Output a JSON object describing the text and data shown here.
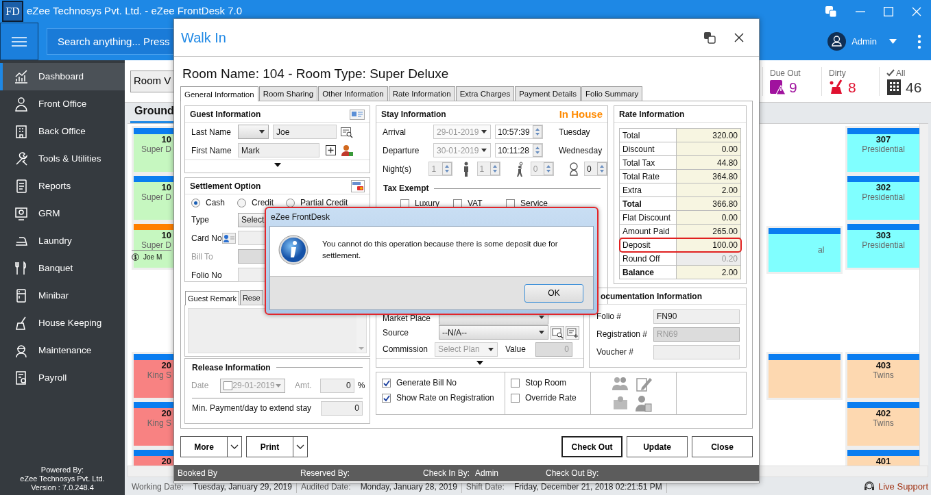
{
  "app": {
    "logo": "FD",
    "title": "eZee Technosys Pvt. Ltd. - eZee FrontDesk 7.0",
    "search": {
      "placeholder": "Search anything... Press"
    },
    "user": "Admin"
  },
  "sidebar": {
    "items": [
      {
        "label": "Dashboard",
        "kind": "dashboard",
        "selected": true
      },
      {
        "label": "Front Office",
        "kind": "front-office",
        "selected": false
      },
      {
        "label": "Back Office",
        "kind": "back-office",
        "selected": false
      },
      {
        "label": "Tools & Utilities",
        "kind": "tools",
        "selected": false
      },
      {
        "label": "Reports",
        "kind": "reports",
        "selected": false
      },
      {
        "label": "GRM",
        "kind": "grm",
        "selected": false
      },
      {
        "label": "Laundry",
        "kind": "laundry",
        "selected": false
      },
      {
        "label": "Banquet",
        "kind": "banquet",
        "selected": false
      },
      {
        "label": "Minibar",
        "kind": "minibar",
        "selected": false
      },
      {
        "label": "House Keeping",
        "kind": "housekeeping",
        "selected": false
      },
      {
        "label": "Maintenance",
        "kind": "maintenance",
        "selected": false
      },
      {
        "label": "Payroll",
        "kind": "payroll",
        "selected": false
      }
    ],
    "footer": [
      "Powered By:",
      "eZee Technosys Pvt. Ltd.",
      "Version : 7.0.248.4"
    ]
  },
  "toolbar": {
    "view_button": "Room V",
    "stats": [
      {
        "label": "Due Out",
        "value": "9",
        "kind": "due-out",
        "color": "#a0129e"
      },
      {
        "label": "Dirty",
        "value": "8",
        "kind": "dirty",
        "color": "#e0102f"
      },
      {
        "label": "All",
        "value": "46",
        "kind": "all",
        "color": "#333333"
      }
    ]
  },
  "floor_tabs": [
    {
      "label": "Ground",
      "selected": true
    }
  ],
  "room_groups": [
    {
      "columns": [
        {
          "rooms": [
            {
              "number": "10",
              "type": "Super D",
              "kind": "vacant",
              "color": "#c6f7c0"
            },
            {
              "number": "10",
              "type": "Super D",
              "kind": "vacant",
              "color": "#c6f7c0"
            },
            {
              "number": "10",
              "type": "Super D",
              "guest": "Joe M",
              "kind": "occupied",
              "color": "#c6f7c0"
            }
          ]
        },
        {
          "rooms": [
            {
              "type": "al",
              "kind": "vacant",
              "color": "#80ffff"
            }
          ]
        },
        {
          "rooms": [
            {
              "number": "307",
              "type": "Presidential",
              "kind": "vacant",
              "color": "#80ffff"
            },
            {
              "number": "302",
              "type": "Presidential",
              "kind": "vacant",
              "color": "#80ffff"
            },
            {
              "number": "303",
              "type": "Presidential",
              "kind": "vacant",
              "color": "#80ffff"
            }
          ]
        }
      ]
    },
    {
      "columns": [
        {
          "rooms": [
            {
              "number": "20",
              "type": "King S",
              "kind": "vacant",
              "color": "#f88282"
            },
            {
              "number": "20",
              "type": "King S",
              "kind": "vacant",
              "color": "#f88282"
            },
            {
              "number": "20",
              "kind": "vacant",
              "color": "#f88282"
            }
          ]
        },
        {
          "rooms": [
            {
              "kind": "vacant",
              "color": "#fdd8b0"
            }
          ]
        },
        {
          "rooms": [
            {
              "number": "403",
              "type": "Twins",
              "kind": "vacant",
              "color": "#fdd8b0"
            },
            {
              "number": "402",
              "type": "Twins",
              "kind": "vacant",
              "color": "#fdd8b0"
            },
            {
              "number": "401",
              "kind": "vacant",
              "color": "#fdd8b0"
            }
          ]
        }
      ]
    }
  ],
  "status_bar": {
    "items": [
      {
        "label": "Working Date:",
        "value": "Tuesday, January 29, 2019"
      },
      {
        "label": "Audited Date:",
        "value": "Monday, January 28, 2019"
      },
      {
        "label": "Shift Date:",
        "value": "Friday, December 21, 2018 02:21:51 PM"
      }
    ],
    "live_support": "Live Support"
  },
  "dialog": {
    "title": "Walk In",
    "heading": "Room Name: 104 - Room Type: Super Deluxe",
    "tabs": [
      {
        "label": "General Information",
        "selected": true
      },
      {
        "label": "Room Sharing",
        "selected": false
      },
      {
        "label": "Other Information",
        "selected": false
      },
      {
        "label": "Rate Information",
        "selected": false
      },
      {
        "label": "Extra Charges",
        "selected": false
      },
      {
        "label": "Payment Details",
        "selected": false
      },
      {
        "label": "Folio Summary",
        "selected": false
      }
    ],
    "guest": {
      "title": "Guest Information",
      "last_name": {
        "label": "Last Name",
        "value": "Joe"
      },
      "first_name": {
        "label": "First Name",
        "value": "Mark"
      }
    },
    "settlement": {
      "title": "Settlement Option",
      "options": [
        {
          "label": "Cash",
          "selected": true
        },
        {
          "label": "Credit",
          "selected": false
        },
        {
          "label": "Partial Credit",
          "selected": false
        }
      ],
      "fields": [
        {
          "label": "Type",
          "kind": "select",
          "value": "Select",
          "disabled": false
        },
        {
          "label": "Card No",
          "kind": "card",
          "disabled": false
        },
        {
          "label": "Bill To",
          "kind": "text",
          "disabled": true
        },
        {
          "label": "Folio No",
          "kind": "text",
          "disabled": false
        }
      ]
    },
    "remarks": {
      "tabs": [
        {
          "label": "Guest Remark",
          "selected": true
        },
        {
          "label": "Rese",
          "selected": false
        }
      ]
    },
    "release": {
      "title": "Release Information",
      "date": {
        "label": "Date",
        "value": "29-01-2019",
        "checked": false
      },
      "amount": {
        "label": "Amt.",
        "value": "0",
        "unit": "%"
      },
      "min_payment": {
        "label": "Min. Payment/day to extend stay",
        "value": "0"
      }
    },
    "stay": {
      "title": "Stay Information",
      "status": "In House",
      "dates": [
        {
          "label": "Arrival",
          "date": "29-01-2019",
          "time": "10:57:39",
          "day": "Tuesday"
        },
        {
          "label": "Departure",
          "date": "30-01-2019",
          "time": "10:11:28",
          "day": "Wednesday"
        }
      ],
      "nights": {
        "label": "Night(s)",
        "value": "1"
      },
      "guests": [
        {
          "kind": "adult",
          "value": "1",
          "disabled": true
        },
        {
          "kind": "child",
          "value": "0",
          "disabled": true
        },
        {
          "kind": "infant",
          "value": "0",
          "disabled": false
        }
      ],
      "tax_exempt": {
        "title": "Tax Exempt",
        "options": [
          {
            "label": "Luxury",
            "checked": false
          },
          {
            "label": "VAT",
            "checked": false
          },
          {
            "label": "Service",
            "checked": false
          }
        ]
      }
    },
    "market": {
      "market_place": {
        "label": "Market Place"
      },
      "source": {
        "label": "Source",
        "value": "--N/A--"
      },
      "commission": {
        "label": "Commission",
        "value": "Select Plan"
      },
      "value": {
        "label": "Value",
        "value": "0"
      }
    },
    "rate": {
      "title": "Rate Information",
      "rows": [
        {
          "label": "Total",
          "value": "320.00",
          "kind": "normal",
          "highlighted": false,
          "disabled": false
        },
        {
          "label": "Discount",
          "value": "0.00",
          "kind": "normal",
          "highlighted": false,
          "disabled": false
        },
        {
          "label": "Total Tax",
          "value": "44.80",
          "kind": "normal",
          "highlighted": false,
          "disabled": false
        },
        {
          "label": "Total Rate",
          "value": "364.80",
          "kind": "normal",
          "highlighted": false,
          "disabled": false
        },
        {
          "label": "Extra",
          "value": "2.00",
          "kind": "normal",
          "highlighted": false,
          "disabled": false
        },
        {
          "label": "Total",
          "value": "366.80",
          "kind": "total",
          "highlighted": false,
          "disabled": false
        },
        {
          "label": "Flat Discount",
          "value": "0.00",
          "kind": "normal",
          "highlighted": false,
          "disabled": false
        },
        {
          "label": "Amount Paid",
          "value": "265.00",
          "kind": "normal",
          "highlighted": false,
          "disabled": false
        },
        {
          "label": "Deposit",
          "value": "100.00",
          "kind": "normal",
          "highlighted": true,
          "disabled": false
        },
        {
          "label": "Round Off",
          "value": "0.20",
          "kind": "normal",
          "highlighted": false,
          "disabled": true
        },
        {
          "label": "Balance",
          "value": "2.00",
          "kind": "total",
          "highlighted": false,
          "disabled": false
        }
      ]
    },
    "documentation": {
      "title": "ocumentation Information",
      "fields": [
        {
          "label": "Folio #",
          "value": "FN90",
          "disabled": false
        },
        {
          "label": "Registration #",
          "value": "RN69",
          "disabled": true
        },
        {
          "label": "Voucher #",
          "disabled": false
        }
      ]
    },
    "option_groups": [
      {
        "options": [
          {
            "label": "Generate Bill No",
            "checked": true
          },
          {
            "label": "Show Rate on Registration",
            "checked": true
          }
        ]
      },
      {
        "options": [
          {
            "label": "Stop Room",
            "checked": false
          },
          {
            "label": "Override Rate",
            "checked": false
          }
        ]
      }
    ],
    "buttons_left": [
      "More",
      "Print"
    ],
    "buttons_right": [
      {
        "label": "Check Out",
        "default": true
      },
      {
        "label": "Update",
        "default": false
      },
      {
        "label": "Close",
        "default": false
      }
    ],
    "footer": [
      {
        "label": "Booked By"
      },
      {
        "label": "Reserved By:"
      },
      {
        "label": "Check In By:",
        "value": "Admin"
      },
      {
        "label": "Check Out By:"
      }
    ]
  },
  "message": {
    "title": "eZee FrontDesk",
    "text": "You cannot do this operation because there is some deposit due for settlement.",
    "button": "OK"
  }
}
